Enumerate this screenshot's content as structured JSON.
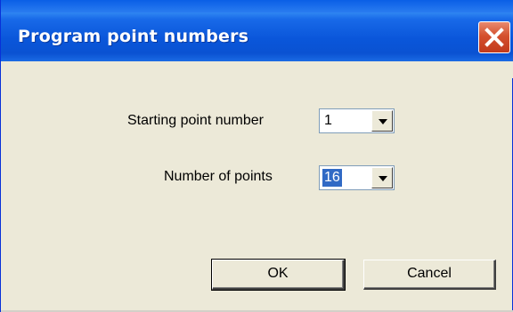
{
  "window": {
    "title": "Program point numbers"
  },
  "form": {
    "starting_point": {
      "label": "Starting point number",
      "value": "1"
    },
    "number_of_points": {
      "label": "Number of points",
      "value": "16"
    }
  },
  "buttons": {
    "ok_label": "OK",
    "cancel_label": "Cancel"
  },
  "icons": {
    "close": "close-icon",
    "dropdown": "chevron-down-icon"
  },
  "colors": {
    "titlebar": "#0A56DA",
    "dialog_bg": "#ECE9D8",
    "close_button": "#D4502E",
    "selection": "#316AC5"
  }
}
